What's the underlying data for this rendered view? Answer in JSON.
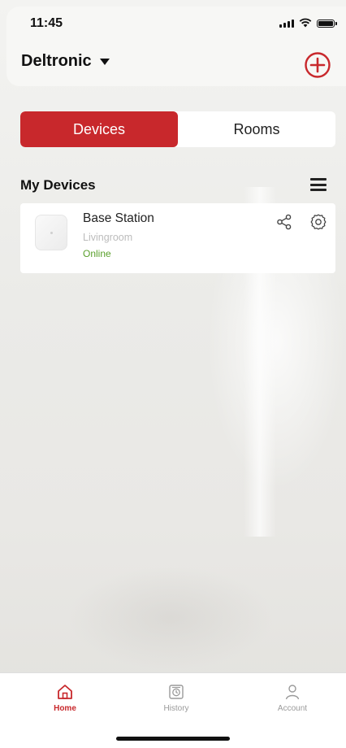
{
  "status_bar": {
    "time": "11:45"
  },
  "header": {
    "home_name": "Deltronic",
    "add_icon": "plus-circle-icon"
  },
  "segments": [
    {
      "label": "Devices",
      "active": true
    },
    {
      "label": "Rooms",
      "active": false
    }
  ],
  "section": {
    "title": "My Devices",
    "menu_icon": "hamburger-menu-icon"
  },
  "devices": [
    {
      "name": "Base Station",
      "room": "Livingroom",
      "status": "Online",
      "status_color": "#5aa02c"
    }
  ],
  "tabbar": {
    "items": [
      {
        "label": "Home",
        "icon": "house-icon",
        "active": true
      },
      {
        "label": "History",
        "icon": "history-icon",
        "active": false
      },
      {
        "label": "Account",
        "icon": "person-icon",
        "active": false
      }
    ]
  },
  "colors": {
    "accent": "#c8282c",
    "online": "#5aa02c"
  }
}
